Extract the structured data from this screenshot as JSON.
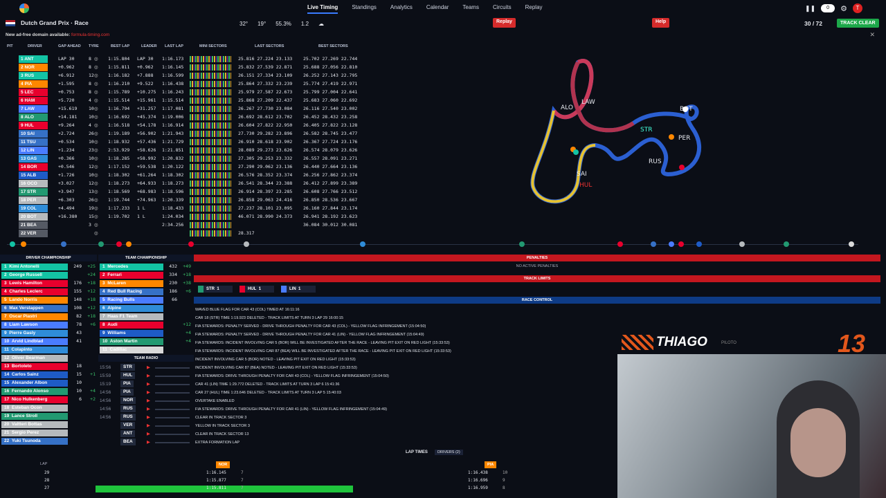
{
  "top": {
    "nav": [
      "Live Timing",
      "Standings",
      "Analytics",
      "Calendar",
      "Teams",
      "Circuits",
      "Replay"
    ],
    "toggle": "0",
    "avatar": "T"
  },
  "header": {
    "race": "Dutch Grand Prix · Race",
    "temp_track": "32°",
    "temp_air": "19°",
    "humidity": "55.3%",
    "wind": "1.2",
    "replay": "Replay",
    "help": "Help",
    "laps": "30 / 72",
    "status": "TRACK CLEAR"
  },
  "ad": {
    "text": "New ad-free domain available:",
    "link": "formula-timing.com"
  },
  "timing": {
    "headers": [
      "PIT",
      "DRIVER",
      "GAP AHEAD",
      "TYRE",
      "BEST LAP",
      "LEADER",
      "LAST LAP",
      "MINI SECTORS",
      "LAST SECTORS",
      "BEST SECTORS"
    ],
    "rows": [
      {
        "p": "1",
        "d": "ANT",
        "gap": "LAP 30",
        "t": "8",
        "best": "1:15.804",
        "lead": "LAP 30",
        "last": "1:16.173",
        "ls": "25.816  27.224  23.133",
        "bs": "25.702  27.269  22.744",
        "c": "#13c3a4"
      },
      {
        "p": "2",
        "d": "NOR",
        "gap": "+0.962",
        "t": "8",
        "best": "1:15.811",
        "lead": "+0.962",
        "last": "1:16.145",
        "ls": "25.832  27.539  22.871",
        "bs": "25.688  27.056  22.810",
        "c": "#ff8700"
      },
      {
        "p": "3",
        "d": "RUS",
        "gap": "+6.912",
        "t": "12",
        "best": "1:16.182",
        "lead": "+7.888",
        "last": "1:16.599",
        "ls": "26.151  27.334  23.109",
        "bs": "26.252  27.143  22.795",
        "c": "#13c3a4"
      },
      {
        "p": "4",
        "d": "PIA",
        "gap": "+1.595",
        "t": "8",
        "best": "1:16.210",
        "lead": "+9.522",
        "last": "1:16.438",
        "ls": "25.864  27.332  23.239",
        "bs": "25.774  27.419  22.971",
        "c": "#ff8700"
      },
      {
        "p": "5",
        "d": "LEC",
        "gap": "+0.753",
        "t": "8",
        "best": "1:15.789",
        "lead": "+10.275",
        "last": "1:16.243",
        "ls": "25.979  27.587  22.673",
        "bs": "25.799  27.004  22.641",
        "c": "#e8002d"
      },
      {
        "p": "6",
        "d": "HAM",
        "gap": "+5.720",
        "t": "4",
        "best": "1:15.514",
        "lead": "+15.961",
        "last": "1:15.514",
        "ls": "25.868  27.209  22.437",
        "bs": "25.683  27.060  22.692",
        "c": "#e8002d"
      },
      {
        "p": "7",
        "d": "LAW",
        "gap": "+15.619",
        "t": "10",
        "best": "1:16.794",
        "lead": "+31.257",
        "last": "1:17.081",
        "ls": "26.267  27.730  23.084",
        "bs": "26.116  27.540  23.002",
        "c": "#4a7cff"
      },
      {
        "p": "8",
        "d": "ALO",
        "gap": "+14.181",
        "t": "10",
        "best": "1:16.692",
        "lead": "+45.374",
        "last": "1:19.006",
        "ls": "26.692  28.612  23.702",
        "bs": "26.452  28.432  23.258",
        "c": "#229971"
      },
      {
        "p": "9",
        "d": "HUL",
        "gap": "+9.264",
        "t": "4",
        "best": "1:16.518",
        "lead": "+54.178",
        "last": "1:16.914",
        "ls": "26.604  27.822  22.950",
        "bs": "26.405  27.822  23.128",
        "c": "#e8002d"
      },
      {
        "p": "10",
        "d": "SAI",
        "gap": "+2.724",
        "t": "26",
        "best": "1:19.189",
        "lead": "+56.902",
        "last": "1:21.943",
        "ls": "27.730  29.282  23.896",
        "bs": "26.582  28.745  23.477",
        "c": "#3671c6"
      },
      {
        "p": "11",
        "d": "TSU",
        "gap": "+0.534",
        "t": "10",
        "best": "1:18.932",
        "lead": "+57.436",
        "last": "1:21.729",
        "ls": "26.910  28.618  23.902",
        "bs": "26.367  27.724  23.176",
        "c": "#3671c6"
      },
      {
        "p": "12",
        "d": "LIN",
        "gap": "+1.234",
        "t": "23",
        "best": "2:53.929",
        "lead": "+58.626",
        "last": "1:21.851",
        "ls": "28.089  29.273  23.626",
        "bs": "26.574  28.079  23.626",
        "c": "#4a7cff"
      },
      {
        "p": "13",
        "d": "GAS",
        "gap": "+0.366",
        "t": "10",
        "best": "1:18.285",
        "lead": "+58.992",
        "last": "1:20.832",
        "ls": "27.305  29.253  23.332",
        "bs": "26.557  28.091  23.271",
        "c": "#2f8cd8"
      },
      {
        "p": "14",
        "d": "BOR",
        "gap": "+0.546",
        "t": "12",
        "best": "1:17.152",
        "lead": "+59.538",
        "last": "1:20.122",
        "ls": "27.290  29.062  23.136",
        "bs": "26.440  27.664  23.136",
        "c": "#e8002d"
      },
      {
        "p": "15",
        "d": "ALB",
        "gap": "+1.726",
        "t": "10",
        "best": "1:18.302",
        "lead": "+61.264",
        "last": "1:18.302",
        "ls": "26.576  28.352  23.374",
        "bs": "26.256  27.862  23.374",
        "c": "#1e5bc6"
      },
      {
        "p": "16",
        "d": "OCO",
        "gap": "+3.027",
        "t": "12",
        "best": "1:18.273",
        "lead": "+64.933",
        "last": "1:18.273",
        "ls": "26.541  28.344  23.388",
        "bs": "26.412  27.899  23.389",
        "c": "#b6babd"
      },
      {
        "p": "17",
        "d": "STR",
        "gap": "+3.947",
        "t": "13",
        "best": "1:18.569",
        "lead": "+68.983",
        "last": "1:18.596",
        "ls": "26.914  28.397  23.285",
        "bs": "26.608  27.766  23.512",
        "c": "#229971"
      },
      {
        "p": "18",
        "d": "PER",
        "gap": "+6.303",
        "t": "26",
        "best": "1:19.744",
        "lead": "+74.963",
        "last": "1:20.339",
        "ls": "26.858  29.063  24.416",
        "bs": "26.850  28.536  23.667",
        "c": "#b6babd"
      },
      {
        "p": "19",
        "d": "COL",
        "gap": "+4.494",
        "t": "19",
        "best": "1:17.233",
        "lead": "1 L",
        "last": "1:18.433",
        "ls": "27.237  28.101  23.095",
        "bs": "26.160  27.844  23.174",
        "c": "#2f8cd8"
      },
      {
        "p": "20",
        "d": "BOT",
        "gap": "+16.380",
        "t": "15",
        "best": "1:19.702",
        "lead": "1 L",
        "last": "1:24.034",
        "ls": "46.071  28.990  24.373",
        "bs": "26.941  28.192  23.623",
        "c": "#b6babd"
      },
      {
        "p": "21",
        "d": "BEA",
        "gap": "",
        "t": "3",
        "best": "",
        "lead": "",
        "last": "2:34.256",
        "ls": "",
        "bs": "36.084  30.012  30.081",
        "c": "#555a64"
      },
      {
        "p": "22",
        "d": "VER",
        "gap": "",
        "t": "",
        "best": "",
        "lead": "",
        "last": "",
        "ls": "28.317",
        "bs": "",
        "c": "#555a64"
      }
    ]
  },
  "map": {
    "labels": [
      "ALO",
      "LAW",
      "BOT",
      "PER",
      "RUS",
      "SAI",
      "HUL",
      "STR"
    ]
  },
  "drivers_champ": {
    "title": "DRIVER CHAMPIONSHIP",
    "rows": [
      [
        "1",
        "Kimi Antonelli",
        "249",
        "+25",
        "#13c3a4"
      ],
      [
        "2",
        "George Russell",
        "",
        "+24",
        "#13c3a4"
      ],
      [
        "3",
        "Lewis Hamilton",
        "176",
        "+18",
        "#e8002d"
      ],
      [
        "4",
        "Charles Leclerc",
        "155",
        "+12",
        "#e8002d"
      ],
      [
        "5",
        "Lando Norris",
        "148",
        "+18",
        "#ff8700"
      ],
      [
        "6",
        "Max Verstappen",
        "108",
        "+12",
        "#3671c6"
      ],
      [
        "7",
        "Oscar Piastri",
        "82",
        "+18",
        "#ff8700"
      ],
      [
        "8",
        "Liam Lawson",
        "78",
        "+6",
        "#4a7cff"
      ],
      [
        "9",
        "Pierre Gasly",
        "43",
        "",
        "#2f8cd8"
      ],
      [
        "10",
        "Arvid Lindblad",
        "41",
        "",
        "#4a7cff"
      ],
      [
        "11",
        "Colapinto",
        "",
        "",
        "#2f8cd8"
      ],
      [
        "12",
        "Oliver Bearman",
        "",
        "",
        "#b6babd"
      ],
      [
        "13",
        "Bortoleto",
        "18",
        "",
        "#e8002d"
      ],
      [
        "14",
        "Carlos Sainz",
        "15",
        "+1",
        "#1e5bc6"
      ],
      [
        "15",
        "Alexander Albon",
        "10",
        "",
        "#1e5bc6"
      ],
      [
        "16",
        "Fernando Alonso",
        "10",
        "+4",
        "#229971"
      ],
      [
        "17",
        "Nico Hulkenberg",
        "6",
        "+2",
        "#e8002d"
      ],
      [
        "18",
        "Esteban Ocon",
        "",
        "",
        "#b6babd"
      ],
      [
        "19",
        "Lance Stroll",
        "",
        "",
        "#229971"
      ],
      [
        "20",
        "Valtteri Bottas",
        "",
        "",
        "#b6babd"
      ],
      [
        "21",
        "Sergio Perez",
        "",
        "",
        "#b6babd"
      ],
      [
        "22",
        "Yuki Tsunoda",
        "",
        "",
        "#3671c6"
      ]
    ]
  },
  "team_champ": {
    "title": "TEAM CHAMPIONSHIP",
    "rows": [
      [
        "1",
        "Mercedes",
        "432",
        "+49",
        "#13c3a4"
      ],
      [
        "2",
        "Ferrari",
        "334",
        "+18",
        "#e8002d"
      ],
      [
        "3",
        "McLaren",
        "230",
        "+38",
        "#ff8700"
      ],
      [
        "4",
        "Red Bull Racing",
        "186",
        "+6",
        "#3671c6"
      ],
      [
        "5",
        "Racing Bulls",
        "66",
        "",
        "#4a7cff"
      ],
      [
        "6",
        "Alpine",
        "",
        "",
        "#2f8cd8"
      ],
      [
        "7",
        "Haas F1 Team",
        "",
        "",
        "#b6babd"
      ],
      [
        "8",
        "Audi",
        "",
        "+12",
        "#e8002d"
      ],
      [
        "9",
        "Williams",
        "",
        "+4",
        "#1e5bc6"
      ],
      [
        "10",
        "Aston Martin",
        "",
        "+4",
        "#229971"
      ],
      [
        "11",
        "Cadillac",
        "",
        "",
        "#d9d9d9"
      ]
    ]
  },
  "radio": {
    "title": "TEAM RADIO",
    "rows": [
      [
        "15:56",
        "STR"
      ],
      [
        "15:59",
        "HUL"
      ],
      [
        "15:19",
        "PIA"
      ],
      [
        "14:56",
        "PIA"
      ],
      [
        "14:56",
        "NOR"
      ],
      [
        "14:56",
        "RUS"
      ],
      [
        "14:56",
        "RUS"
      ],
      [
        "",
        "VER"
      ],
      [
        "",
        "ANT"
      ],
      [
        "",
        "BEA"
      ]
    ]
  },
  "penalties": {
    "title": "PENALTIES",
    "empty": "NO ACTIVE PENALTIES"
  },
  "track_limits": {
    "title": "TRACK LIMITS",
    "chips": [
      [
        "STR",
        "1",
        "#229971"
      ],
      [
        "HUL",
        "1",
        "#e8002d"
      ],
      [
        "LIN",
        "1",
        "#4a7cff"
      ]
    ]
  },
  "race_control": {
    "title": "RACE CONTROL",
    "messages": [
      "WAVED BLUE FLAG FOR CAR 43 (COL) TIMED AT 16:11:16",
      "CAR 18 (STR) TIME 1:19.923 DELETED - TRACK LIMITS AT TURN 3 LAP 29 16:00:15",
      "FIA STEWARDS: PENALTY SERVED - DRIVE THROUGH PENALTY FOR CAR 43 (COL) - YELLOW FLAG INFRINGEMENT (15:04:50)",
      "FIA STEWARDS: PENALTY SERVED - DRIVE THROUGH PENALTY FOR CAR 41 (LIN) - YELLOW FLAG INFRINGEMENT (15:04:49)",
      "FIA STEWARDS: INCIDENT INVOLVING CAR 5 (BOR) WILL BE INVESTIGATED AFTER THE RACE - LEAVING PIT EXIT ON RED LIGHT (15:33:53)",
      "FIA STEWARDS: INCIDENT INVOLVING CAR 87 (BEA) WILL BE INVESTIGATED AFTER THE RACE - LEAVING PIT EXIT ON RED LIGHT (15:33:53)",
      "INCIDENT INVOLVING CAR 5 (BOR) NOTED - LEAVING PIT EXIT ON RED LIGHT (15:33:53)",
      "INCIDENT INVOLVING CAR 87 (BEA) NOTED - LEAVING PIT EXIT ON RED LIGHT (15:33:53)",
      "FIA STEWARDS: DRIVE THROUGH PENALTY FOR CAR 43 (COL) - YELLOW FLAG INFRINGEMENT (15:04:50)",
      "CAR 41 (LIN) TIME 1:29.772 DELETED - TRACK LIMITS AT TURN 3 LAP 6 15:41:36",
      "CAR 27 (HUL) TIME 1:23.646 DELETED - TRACK LIMITS AT TURN 3 LAP 5 15:40:03",
      "OVERTAKE ENABLED",
      "FIA STEWARDS: DRIVE THROUGH PENALTY FOR CAR 41 (LIN) - YELLOW FLAG INFRINGEMENT (15:04:49)",
      "CLEAR IN TRACK SECTOR 3",
      "YELLOW IN TRACK SECTOR 3",
      "CLEAR IN TRACK SECTOR 13",
      "EXTRA FORMATION LAP"
    ]
  },
  "laptimes": {
    "title": "LAP TIMES",
    "drivers_btn": "DRIVERS (2)",
    "lap_header": "LAP",
    "d1": "NOR",
    "d2": "PIA",
    "rows": [
      [
        "29",
        "1:16.145",
        "7",
        "1:16.438",
        "10"
      ],
      [
        "28",
        "1:15.877",
        "7",
        "1:16.696",
        "9"
      ],
      [
        "27",
        "1:15.811",
        "7",
        "1:16.959",
        "8"
      ]
    ]
  },
  "webcam": {
    "name": "THIAGO",
    "sub": "PILOTO",
    "number": "13"
  }
}
